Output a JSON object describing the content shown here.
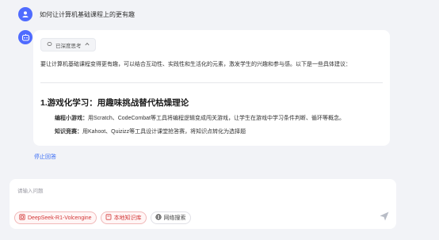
{
  "user": {
    "question": "如何让计算机基础课程上的更有趣"
  },
  "answer": {
    "think_label": "已深度思考",
    "intro": "要让计算机基础课程变得更有趣，可以结合互动性、实践性和生活化的元素，激发学生的兴趣和参与感。以下是一些具体建议：",
    "section_title": "1.游戏化学习：用趣味挑战替代枯燥理论",
    "bullets": [
      {
        "label": "编程小游戏：",
        "text": "用Scratch、CodeCombat等工具将编程逻辑变成闯关游戏，让学生在游戏中学习条件判断、循环等概念。"
      },
      {
        "label": "知识竞赛：",
        "text": "用Kahoot、Quizizz等工具设计课堂抢答赛，将知识点转化为选择题"
      }
    ]
  },
  "stop_label": "停止回答",
  "input": {
    "placeholder": "请输入问题",
    "chips": [
      {
        "label": "DeepSeek-R1-Volcengine",
        "icon": "model-icon"
      },
      {
        "label": "本地知识库",
        "icon": "knowledge-base-icon"
      },
      {
        "label": "网络搜索",
        "icon": "globe-icon"
      }
    ],
    "send_icon": "send-icon"
  },
  "colors": {
    "accent": "#4f6bff",
    "link": "#3b6df5",
    "chip_red": "#d33838"
  }
}
